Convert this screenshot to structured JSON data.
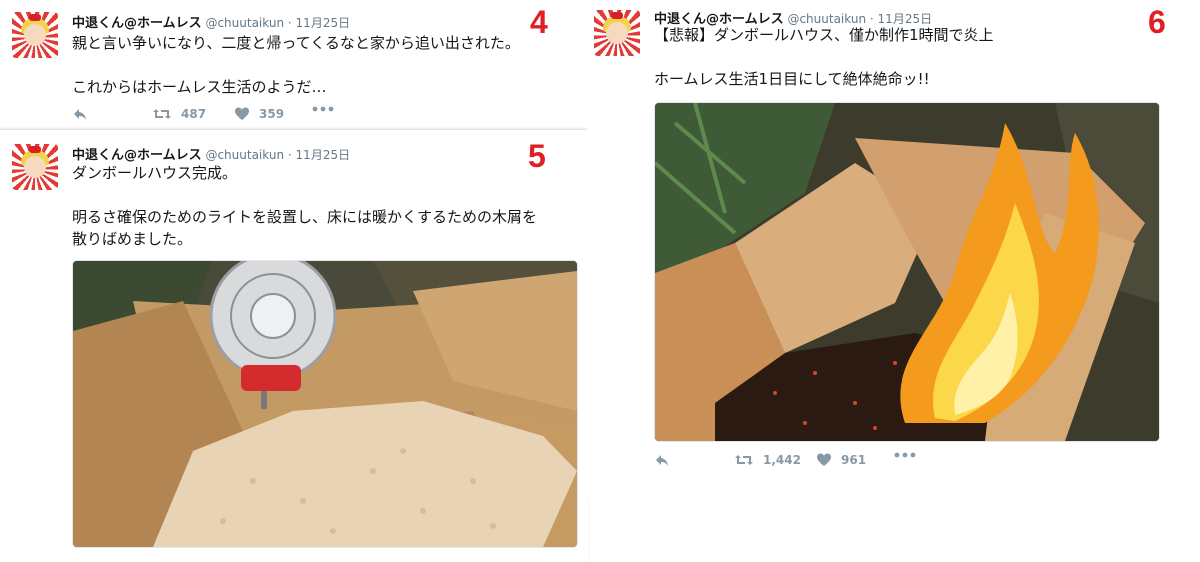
{
  "tweets": [
    {
      "number": "4",
      "user": {
        "name": "中退くん@ホームレス",
        "handle": "@chuutaikun"
      },
      "dot": "·",
      "date": "11月25日",
      "text": "親と言い争いになり、二度と帰ってくるなと家から追い出された。\n\nこれからはホームレス生活のようだ…",
      "retweets": "487",
      "likes": "359"
    },
    {
      "number": "5",
      "user": {
        "name": "中退くん@ホームレス",
        "handle": "@chuutaikun"
      },
      "dot": "·",
      "date": "11月25日",
      "text": "ダンボールハウス完成。\n\n明るさ確保のためのライトを設置し、床には暖かくするための木屑を\n散りばめました。"
    },
    {
      "number": "6",
      "user": {
        "name": "中退くん@ホームレス",
        "handle": "@chuutaikun"
      },
      "dot": "·",
      "date": "11月25日",
      "text": "【悲報】ダンボールハウス、僅か制作1時間で炎上\n\nホームレス生活1日目にして絶体絶命ッ!!",
      "retweets": "1,442",
      "likes": "961"
    }
  ],
  "icons": {
    "reply": "reply-icon",
    "retweet": "retweet-icon",
    "like": "heart-icon",
    "more": "more-icon"
  },
  "colors": {
    "annotation_red": "#e01e24",
    "action_gray": "#8899a6",
    "handle_gray": "#657786"
  }
}
